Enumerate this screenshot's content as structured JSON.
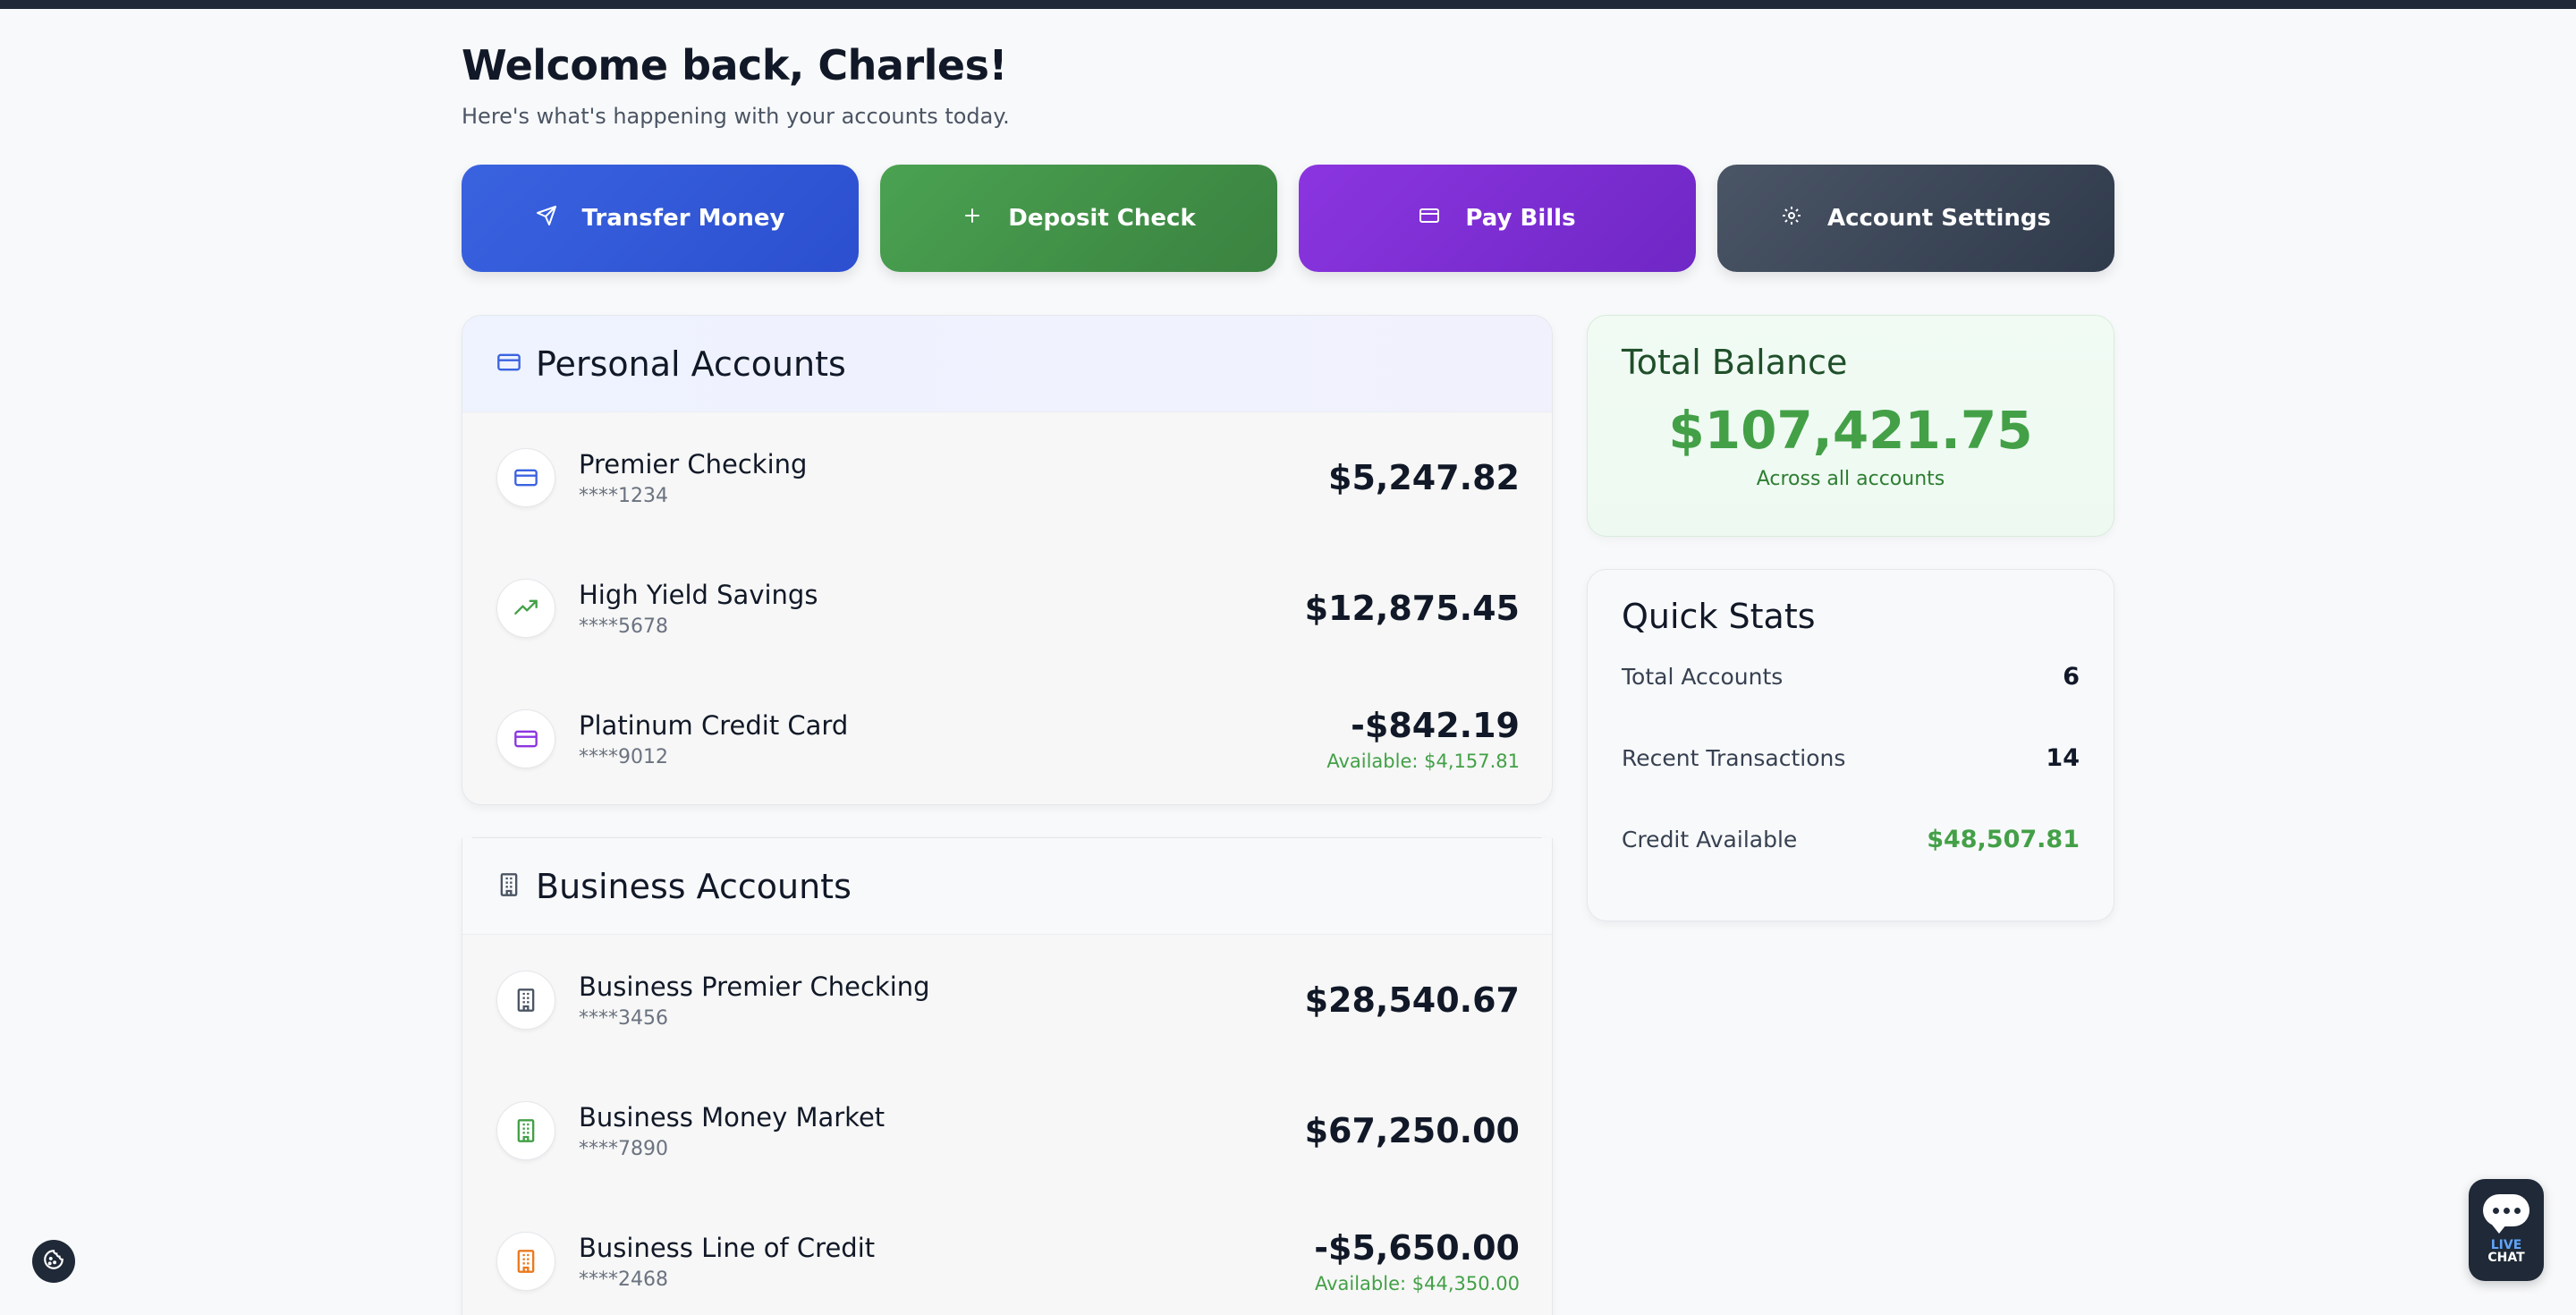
{
  "header": {
    "welcome": "Welcome back, Charles!",
    "subtitle": "Here's what's happening with your accounts today."
  },
  "actions": [
    {
      "label": "Transfer Money",
      "icon": "send-icon",
      "color": "#3a63e0"
    },
    {
      "label": "Deposit Check",
      "icon": "plus-icon",
      "color": "#4aa251"
    },
    {
      "label": "Pay Bills",
      "icon": "credit-card-icon",
      "color": "#8b35e0"
    },
    {
      "label": "Account Settings",
      "icon": "gear-icon",
      "color": "#4a5566"
    }
  ],
  "personal": {
    "title": "Personal Accounts",
    "accounts": [
      {
        "name": "Premier Checking",
        "number": "****1234",
        "balance": "$5,247.82",
        "available": "",
        "icon": "credit-card-icon",
        "icon_color": "#3b63e0"
      },
      {
        "name": "High Yield Savings",
        "number": "****5678",
        "balance": "$12,875.45",
        "available": "",
        "icon": "trending-up-icon",
        "icon_color": "#43a047"
      },
      {
        "name": "Platinum Credit Card",
        "number": "****9012",
        "balance": "-$842.19",
        "available": "Available: $4,157.81",
        "icon": "credit-card-icon",
        "icon_color": "#8b35e0"
      }
    ]
  },
  "business": {
    "title": "Business Accounts",
    "accounts": [
      {
        "name": "Business Premier Checking",
        "number": "****3456",
        "balance": "$28,540.67",
        "available": "",
        "icon": "building-icon",
        "icon_color": "#4b5563"
      },
      {
        "name": "Business Money Market",
        "number": "****7890",
        "balance": "$67,250.00",
        "available": "",
        "icon": "building-icon",
        "icon_color": "#43a047"
      },
      {
        "name": "Business Line of Credit",
        "number": "****2468",
        "balance": "-$5,650.00",
        "available": "Available: $44,350.00",
        "icon": "building-icon",
        "icon_color": "#ea7a1f"
      }
    ]
  },
  "total": {
    "title": "Total Balance",
    "amount": "$107,421.75",
    "subtitle": "Across all accounts"
  },
  "stats": {
    "title": "Quick Stats",
    "rows": [
      {
        "label": "Total Accounts",
        "value": "6"
      },
      {
        "label": "Recent Transactions",
        "value": "14"
      },
      {
        "label": "Credit Available",
        "value": "$48,507.81"
      }
    ]
  },
  "chat": {
    "live": "LIVE",
    "label": "CHAT"
  }
}
